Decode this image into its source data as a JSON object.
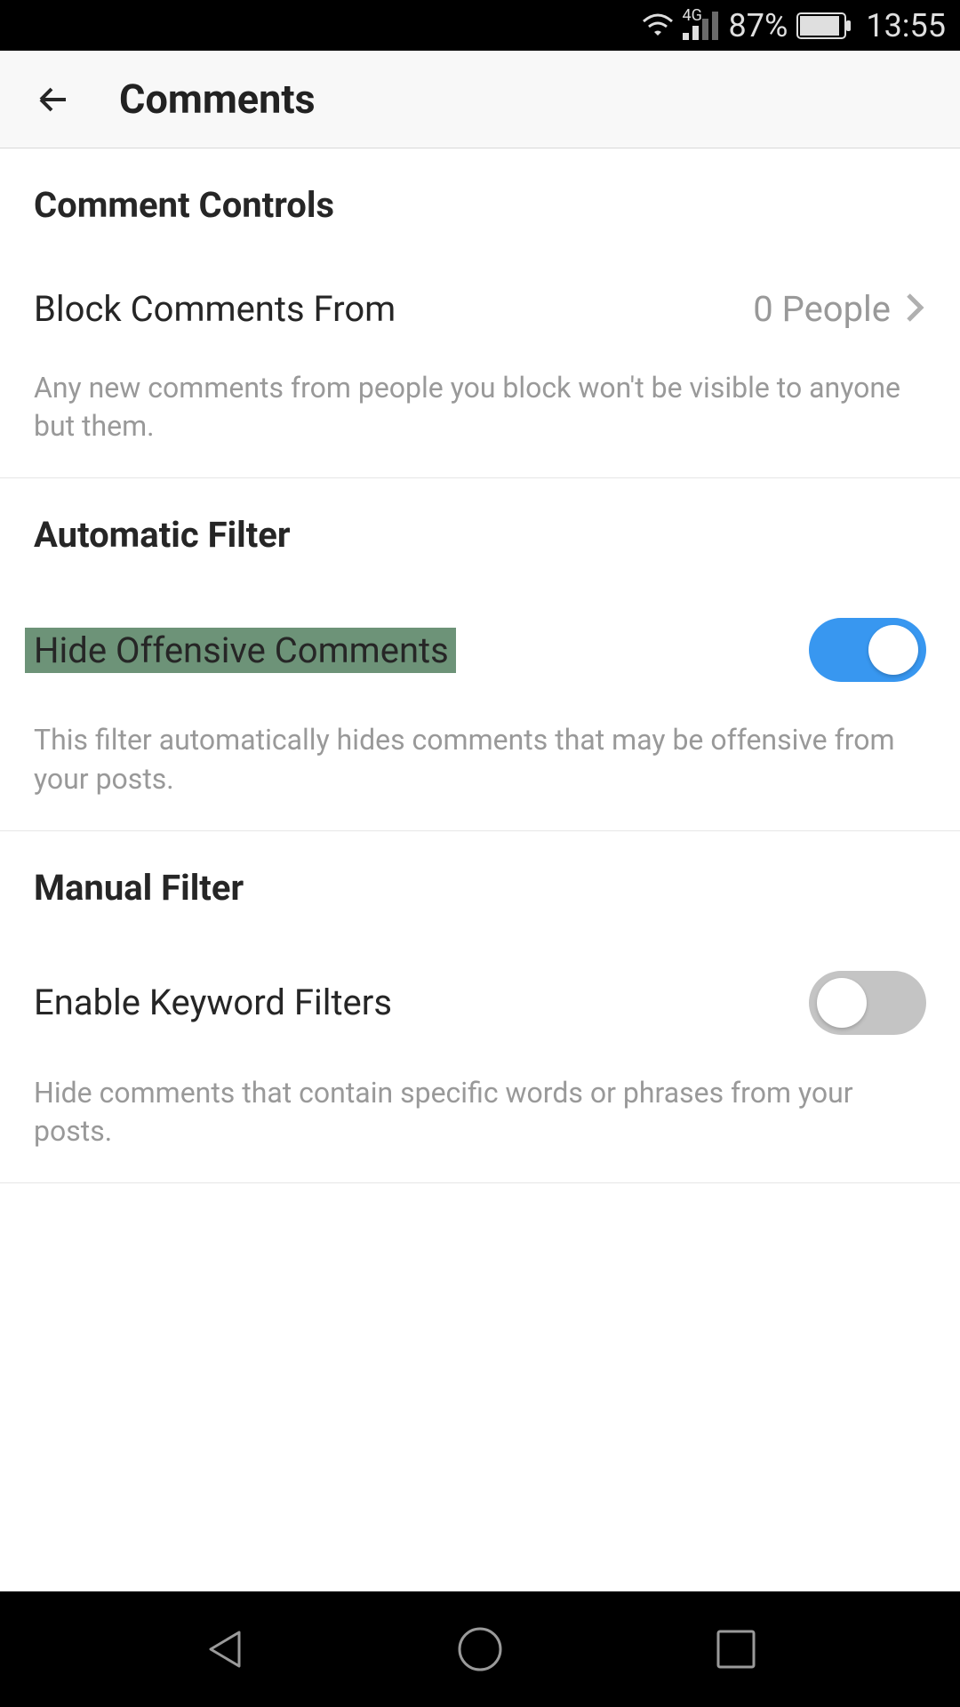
{
  "status_bar": {
    "network_type": "4G",
    "battery_percent": "87%",
    "time": "13:55"
  },
  "header": {
    "title": "Comments"
  },
  "sections": {
    "comment_controls": {
      "title": "Comment Controls",
      "block_comments_label": "Block Comments From",
      "block_comments_value": "0 People",
      "block_comments_description": "Any new comments from people you block won't be visible to anyone but them."
    },
    "automatic_filter": {
      "title": "Automatic Filter",
      "hide_offensive_label": "Hide Offensive Comments",
      "hide_offensive_enabled": true,
      "hide_offensive_description": "This filter automatically hides comments that may be offensive from your posts."
    },
    "manual_filter": {
      "title": "Manual Filter",
      "keyword_filter_label": "Enable Keyword Filters",
      "keyword_filter_enabled": false,
      "keyword_filter_description": "Hide comments that contain specific words or phrases from your posts."
    }
  }
}
